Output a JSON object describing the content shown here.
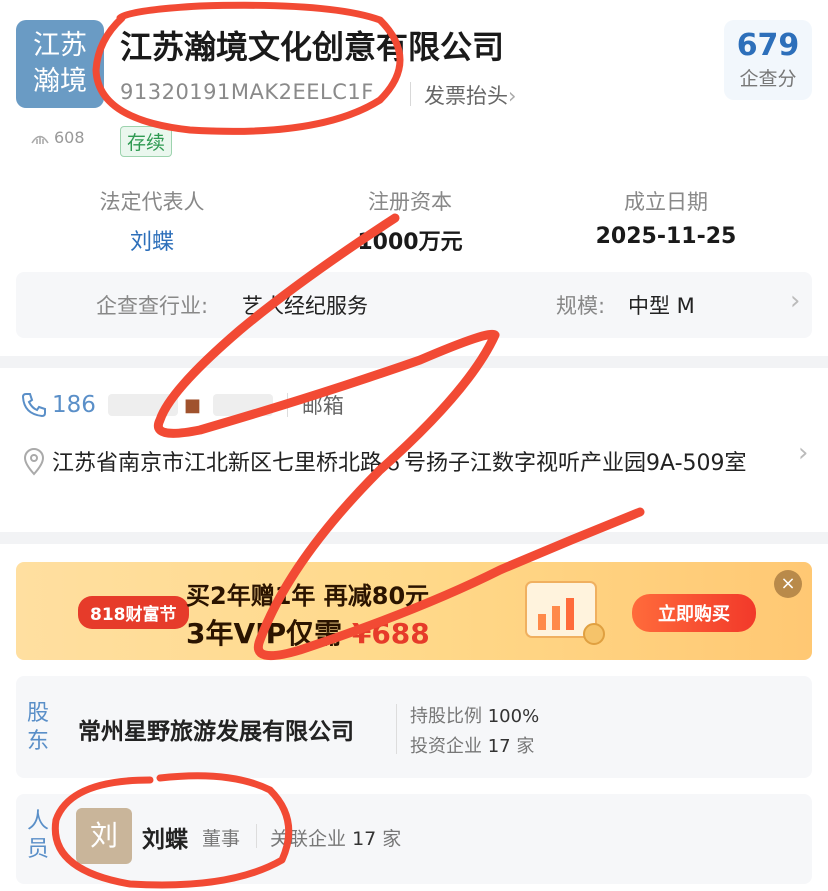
{
  "company": {
    "logo_line1": "江苏",
    "logo_line2": "瀚境",
    "name": "江苏瀚境文化创意有限公司",
    "credit_code": "91320191MAK2EELC1F",
    "invoice_label": "发票抬头",
    "score": "679",
    "score_label": "企查分",
    "views": "608",
    "status": "存续"
  },
  "info": {
    "rep_label": "法定代表人",
    "rep_value": "刘蝶",
    "capital_label": "注册资本",
    "capital_value": "1000万元",
    "founded_label": "成立日期",
    "founded_value": "2025-11-25"
  },
  "industry": {
    "label": "企查查行业:",
    "value": "艺人经纪服务",
    "scale_label": "规模:",
    "scale_value": "中型 M"
  },
  "contact": {
    "phone_prefix": "186",
    "email_label": "邮箱",
    "address": "江苏省南京市江北新区七里桥北路６号扬子江数字视听产业园9A-509室"
  },
  "banner": {
    "tag": "818财富节",
    "line1": "买2年赠1年  再减80元",
    "line2_prefix": "3年VIP仅需",
    "price": "¥688",
    "buy_label": "立即购买",
    "close": "×"
  },
  "shareholder": {
    "section_line1": "股",
    "section_line2": "东",
    "name": "常州星野旅游发展有限公司",
    "ratio_label": "持股比例",
    "ratio_value": "100%",
    "invest_label": "投资企业",
    "invest_value": "17",
    "invest_unit": "家"
  },
  "personnel": {
    "section_line1": "人",
    "section_line2": "员",
    "avatar": "刘",
    "name": "刘蝶",
    "role": "董事",
    "related_label": "关联企业",
    "related_value": "17",
    "related_unit": "家"
  },
  "colors": {
    "accent_blue": "#2d6fba",
    "status_green": "#2f9a52",
    "annotation_red": "#f24a34",
    "banner_orange": "#ffd98a"
  }
}
